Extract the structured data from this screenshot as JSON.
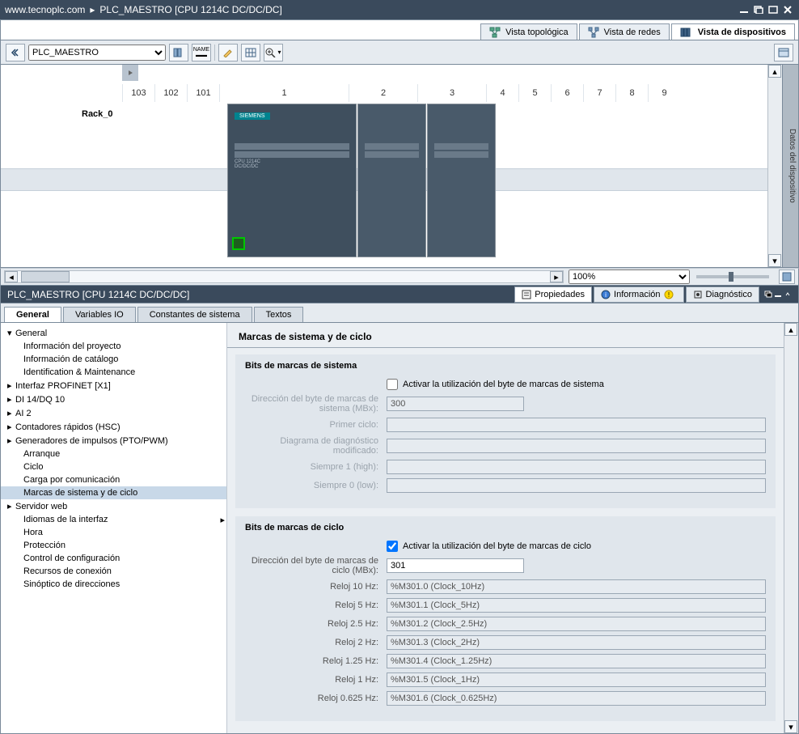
{
  "titlebar": {
    "crumb1": "www.tecnoplc.com",
    "crumb2": "PLC_MAESTRO [CPU 1214C DC/DC/DC]"
  },
  "viewtabs": {
    "topo": "Vista topológica",
    "net": "Vista de redes",
    "dev": "Vista de dispositivos"
  },
  "toolbar": {
    "device_select": "PLC_MAESTRO"
  },
  "rack": {
    "label": "Rack_0",
    "slots": [
      "103",
      "102",
      "101",
      "1",
      "2",
      "3",
      "4",
      "5",
      "6",
      "7",
      "8",
      "9"
    ],
    "cpu_brand": "SIEMENS",
    "cpu_model1": "CPU 1214C",
    "cpu_model2": "DC/DC/DC"
  },
  "statusbar": {
    "zoom": "100%"
  },
  "prop_header": {
    "title": "PLC_MAESTRO [CPU 1214C DC/DC/DC]",
    "tab_prop": "Propiedades",
    "tab_info": "Información",
    "tab_diag": "Diagnóstico"
  },
  "inner_tabs": {
    "general": "General",
    "vars": "Variables IO",
    "const": "Constantes de sistema",
    "texts": "Textos"
  },
  "tree": {
    "general": "General",
    "info_proyecto": "Información del proyecto",
    "info_catalogo": "Información de catálogo",
    "ident": "Identification & Maintenance",
    "profinet": "Interfaz PROFINET [X1]",
    "didq": "DI 14/DQ 10",
    "ai2": "AI 2",
    "hsc": "Contadores rápidos (HSC)",
    "pto": "Generadores de impulsos (PTO/PWM)",
    "arranque": "Arranque",
    "ciclo": "Ciclo",
    "carga": "Carga por comunicación",
    "marcas": "Marcas de sistema y de ciclo",
    "web": "Servidor web",
    "idiomas": "Idiomas de la interfaz",
    "hora": "Hora",
    "proteccion": "Protección",
    "control": "Control de configuración",
    "recursos": "Recursos de conexión",
    "sinoptico": "Sinóptico de direcciones"
  },
  "content": {
    "page_title": "Marcas de sistema y de ciclo",
    "sys_group": "Bits de marcas de sistema",
    "sys_chk": "Activar la utilización del byte de marcas de sistema",
    "sys_addr_lbl": "Dirección del byte de marcas de sistema (MBx):",
    "sys_addr_val": "300",
    "primer_ciclo": "Primer ciclo:",
    "diag_mod": "Diagrama de diagnóstico modificado:",
    "siempre1": "Siempre 1 (high):",
    "siempre0": "Siempre 0 (low):",
    "cyc_group": "Bits de marcas de ciclo",
    "cyc_chk": "Activar la utilización del byte de marcas de ciclo",
    "cyc_addr_lbl": "Dirección del byte de marcas de ciclo (MBx):",
    "cyc_addr_val": "301",
    "r10_lbl": "Reloj 10 Hz:",
    "r10_val": "%M301.0 (Clock_10Hz)",
    "r5_lbl": "Reloj 5 Hz:",
    "r5_val": "%M301.1 (Clock_5Hz)",
    "r25_lbl": "Reloj 2.5 Hz:",
    "r25_val": "%M301.2 (Clock_2.5Hz)",
    "r2_lbl": "Reloj 2 Hz:",
    "r2_val": "%M301.3 (Clock_2Hz)",
    "r125_lbl": "Reloj 1.25 Hz:",
    "r125_val": "%M301.4 (Clock_1.25Hz)",
    "r1_lbl": "Reloj 1 Hz:",
    "r1_val": "%M301.5 (Clock_1Hz)",
    "r0625_lbl": "Reloj 0.625 Hz:",
    "r0625_val": "%M301.6 (Clock_0.625Hz)"
  },
  "side_panel": "Datos del dispositivo"
}
